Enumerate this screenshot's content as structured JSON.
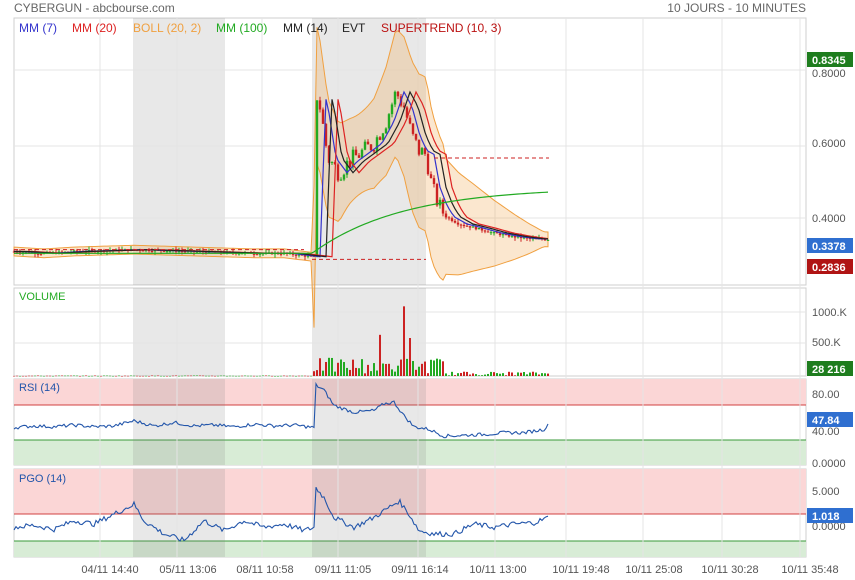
{
  "header": {
    "title": "CYBERGUN - abcbourse.com",
    "period": "10 JOURS - 10 MINUTES"
  },
  "legend": [
    {
      "label": "MM (7)",
      "color": "#3333cc"
    },
    {
      "label": "MM (20)",
      "color": "#dd2222"
    },
    {
      "label": "BOLL (20, 2)",
      "color": "#f0a040"
    },
    {
      "label": "MM (100)",
      "color": "#22aa22"
    },
    {
      "label": "MM (14)",
      "color": "#222222"
    },
    {
      "label": "EVT",
      "color": "#222222"
    },
    {
      "label": "SUPERTREND (10, 3)",
      "color": "#bb1111"
    }
  ],
  "price_panel": {
    "ticks": [
      "0.8000",
      "0.6000",
      "0.4000"
    ],
    "badges": [
      {
        "label": "0.8345",
        "color": "#1e7d1e"
      },
      {
        "label": "0.3378",
        "color": "#2f6fd0"
      },
      {
        "label": "0.2836",
        "color": "#b01414"
      }
    ]
  },
  "volume_panel": {
    "title": "VOLUME",
    "ticks": [
      "1000.K",
      "500.K"
    ],
    "badge": {
      "label": "28 216",
      "color": "#1e7d1e"
    }
  },
  "rsi_panel": {
    "title": "RSI (14)",
    "ticks": [
      "80.00",
      "40.00",
      "0.0000"
    ],
    "badge": {
      "label": "47.84",
      "color": "#2f6fd0"
    }
  },
  "pgo_panel": {
    "title": "PGO (14)",
    "ticks": [
      "5.000",
      "0.0000"
    ],
    "badge": {
      "label": "1.018",
      "color": "#2f6fd0"
    }
  },
  "x_axis": {
    "labels": [
      "04/11 14:40",
      "05/11 13:06",
      "08/11 10:58",
      "09/11 11:05",
      "09/11 16:14",
      "10/11 13:00",
      "10/11 19:48",
      "10/11 25:08",
      "10/11 30:28",
      "10/11 35:48"
    ]
  },
  "chart_data": {
    "type": "candlestick",
    "title": "CYBERGUN",
    "x_labels": [
      "04/11 14:40",
      "05/11 13:06",
      "08/11 10:58",
      "09/11 11:05",
      "09/11 16:14",
      "10/11 13:00",
      "10/11 19:48",
      "10/11 25:08",
      "10/11 30:28",
      "10/11 35:48"
    ],
    "price": {
      "ylim": [
        0.2,
        0.85
      ],
      "last": 0.3378,
      "high_marker": 0.8345,
      "low_marker": 0.2836,
      "series_close_approx": [
        [
          0,
          0.305
        ],
        [
          30,
          0.3
        ],
        [
          60,
          0.305
        ],
        [
          120,
          0.31
        ],
        [
          180,
          0.305
        ],
        [
          240,
          0.3
        ],
        [
          270,
          0.3
        ],
        [
          300,
          0.29
        ],
        [
          302,
          0.74
        ],
        [
          306,
          0.7
        ],
        [
          314,
          0.56
        ],
        [
          325,
          0.52
        ],
        [
          335,
          0.55
        ],
        [
          345,
          0.57
        ],
        [
          360,
          0.6
        ],
        [
          372,
          0.66
        ],
        [
          382,
          0.74
        ],
        [
          390,
          0.7
        ],
        [
          398,
          0.62
        ],
        [
          405,
          0.58
        ],
        [
          412,
          0.57
        ],
        [
          418,
          0.48
        ],
        [
          425,
          0.43
        ],
        [
          432,
          0.4
        ],
        [
          445,
          0.38
        ],
        [
          460,
          0.37
        ],
        [
          480,
          0.355
        ],
        [
          500,
          0.345
        ],
        [
          515,
          0.34
        ],
        [
          535,
          0.338
        ]
      ],
      "supertrend_levels": [
        0.2836,
        0.56
      ]
    },
    "volume": {
      "ylim": [
        0,
        1200000
      ],
      "last": 28216
    },
    "rsi": {
      "ylim": [
        0,
        100
      ],
      "overbought": 70,
      "oversold": 30,
      "last": 47.84,
      "series_approx": [
        [
          0,
          44
        ],
        [
          20,
          46
        ],
        [
          40,
          45
        ],
        [
          60,
          47
        ],
        [
          80,
          45
        ],
        [
          100,
          46
        ],
        [
          120,
          52
        ],
        [
          140,
          46
        ],
        [
          160,
          50
        ],
        [
          180,
          46
        ],
        [
          200,
          47
        ],
        [
          220,
          45
        ],
        [
          240,
          48
        ],
        [
          260,
          46
        ],
        [
          280,
          47
        ],
        [
          300,
          44
        ],
        [
          302,
          94
        ],
        [
          310,
          88
        ],
        [
          320,
          70
        ],
        [
          340,
          62
        ],
        [
          360,
          64
        ],
        [
          370,
          72
        ],
        [
          380,
          74
        ],
        [
          390,
          58
        ],
        [
          400,
          45
        ],
        [
          415,
          42
        ],
        [
          430,
          34
        ],
        [
          450,
          35
        ],
        [
          470,
          36
        ],
        [
          490,
          38
        ],
        [
          510,
          38
        ],
        [
          530,
          42
        ],
        [
          535,
          47.84
        ]
      ]
    },
    "pgo": {
      "ylim": [
        -4,
        8
      ],
      "last": 1.018,
      "series_approx": [
        [
          0,
          -0.5
        ],
        [
          20,
          -0.2
        ],
        [
          40,
          -0.8
        ],
        [
          60,
          0.5
        ],
        [
          80,
          0.0
        ],
        [
          100,
          1.5
        ],
        [
          120,
          3.0
        ],
        [
          130,
          0.5
        ],
        [
          150,
          -1.5
        ],
        [
          170,
          -2.5
        ],
        [
          190,
          0.5
        ],
        [
          210,
          -1.0
        ],
        [
          230,
          0.5
        ],
        [
          250,
          -0.5
        ],
        [
          270,
          0.0
        ],
        [
          290,
          -1.0
        ],
        [
          300,
          -0.5
        ],
        [
          302,
          5.5
        ],
        [
          310,
          4.0
        ],
        [
          320,
          1.0
        ],
        [
          340,
          -0.5
        ],
        [
          360,
          1.0
        ],
        [
          375,
          2.5
        ],
        [
          385,
          3.5
        ],
        [
          395,
          1.5
        ],
        [
          405,
          -1.0
        ],
        [
          420,
          -1.5
        ],
        [
          440,
          -1.5
        ],
        [
          460,
          0.0
        ],
        [
          480,
          -0.5
        ],
        [
          500,
          0.0
        ],
        [
          520,
          0.2
        ],
        [
          535,
          1.018
        ]
      ]
    }
  }
}
